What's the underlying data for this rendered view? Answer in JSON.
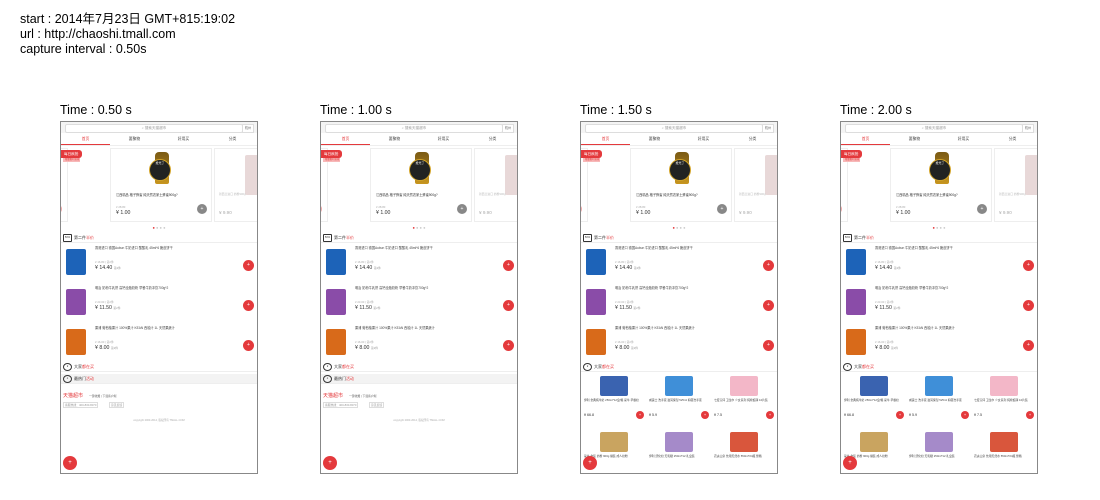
{
  "meta": {
    "start": "start : 2014年7月23日 GMT+815:19:02",
    "url": "url : http://chaoshi.tmall.com",
    "interval": "capture interval : 0.50s"
  },
  "frames": [
    {
      "title": "Time : 0.50 s"
    },
    {
      "title": "Time : 1.00 s"
    },
    {
      "title": "Time : 1.50 s"
    },
    {
      "title": "Time : 2.00 s"
    }
  ],
  "app": {
    "search_placeholder": "搜索天猫超市",
    "search_btn": "杭州",
    "tabs": [
      "首页",
      "要聚物",
      "好用买",
      "分类"
    ],
    "deal_badge": "每日疯抢",
    "deal_badge_sub": "限量限时疯抢",
    "deal_sticker": "抢光了",
    "deal_name": "江西精品 格子蜂蜜 纯天然农家土蜂蜜900g?",
    "deal_old": "¥ 28.80",
    "deal_price": "¥ 1.00",
    "side_name": "新西兰进口 奶粉900g",
    "side_price": "¥ 9.90",
    "dots": "● ● ● ●",
    "section_second": "第二件",
    "section_second_red": "半价",
    "section_second_icon": "50%",
    "items": [
      {
        "name": "香港进口 德国Aubun 牛奶进口 酸酸乳 45ml*6 脆皮饼干",
        "old": "¥ 16.80 | 第2件",
        "price": "¥ 14.40",
        "unit": "第2件"
      },
      {
        "name": "明治 奶粉牛乳饼 高钙全脂奶粉 早餐牛奶冲饮700g*2",
        "old": "¥ 23.00 | 第2件",
        "price": "¥ 11.50",
        "unit": "第2件"
      },
      {
        "name": "果浦 葡萄柚果汁 100%果汁 KEAN 西柚汁 1L 天然果蔬汁",
        "old": "¥ 16.00 | 第2件",
        "price": "¥ 8.00",
        "unit": "第2件"
      }
    ],
    "section_hot": "大家",
    "section_hot_red": "都在买",
    "section_popular": "最热门",
    "section_popular_red": "活动",
    "footer_brand": "天猫超市",
    "footer_links": "一键收藏 | 下载客户端",
    "footer_phone": "客服热线：400-830-8070",
    "footer_feedback": "意见反馈",
    "copyright": "copyright 2003-2014, 版权所有 TMALL.COM",
    "grid": [
      {
        "name": "伊利 金典纯牛奶 250ml*12盒/箱 蒙牛 早餐奶",
        "price": "¥ 66.8"
      },
      {
        "name": "威露士 洗手液 滋润保湿 525ml 抑菌洗手液",
        "price": "¥ 5.9"
      },
      {
        "name": "七度空间 卫生巾 少女系列 纯棉超薄 10片装",
        "price": "¥ 7.5"
      },
      {
        "name": "蒙牛 金装 奶粉 900g 罐装 成人奶粉",
        "price": "¥ 99.0"
      },
      {
        "name": "伊利 舒化奶 无乳糖 250ml*12 礼盒装",
        "price": "¥ 45.0"
      },
      {
        "name": "农夫山泉 饮用天然水 550ml*24瓶 整箱",
        "price": "¥ 29.9"
      }
    ],
    "cart_icon": "🛒"
  },
  "colors": {
    "accent": "#e4393c"
  }
}
